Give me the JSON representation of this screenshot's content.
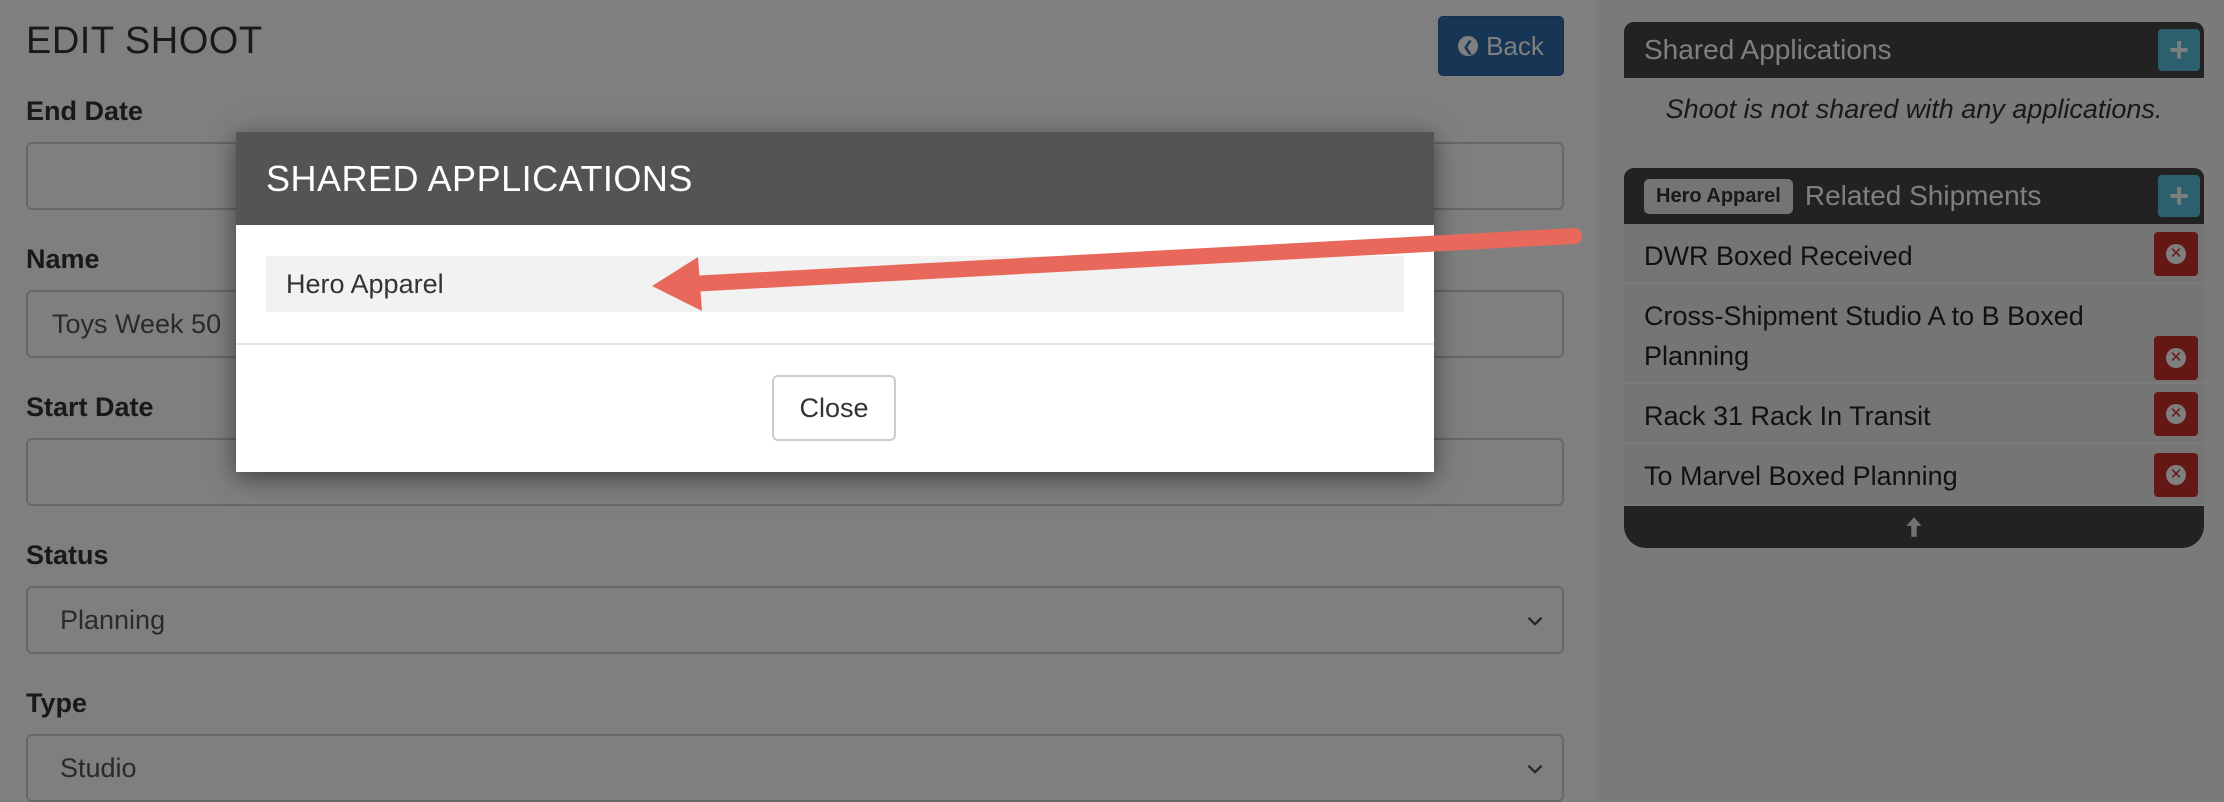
{
  "page": {
    "title": "EDIT SHOOT",
    "back_label": "Back"
  },
  "form": {
    "end_date": {
      "label": "End Date",
      "value": ""
    },
    "name": {
      "label": "Name",
      "value": "Toys Week 50"
    },
    "start_date": {
      "label": "Start Date",
      "value": ""
    },
    "status": {
      "label": "Status",
      "value": "Planning"
    },
    "type": {
      "label": "Type",
      "value": "Studio"
    }
  },
  "sidebar": {
    "shared_apps": {
      "title": "Shared Applications",
      "empty_text": "Shoot is not shared with any applications."
    },
    "related": {
      "tag": "Hero Apparel",
      "title": "Related Shipments",
      "items": [
        "DWR Boxed Received",
        "Cross-Shipment Studio A to B Boxed Planning",
        "Rack 31 Rack In Transit",
        "To Marvel Boxed Planning"
      ]
    }
  },
  "modal": {
    "title": "SHARED APPLICATIONS",
    "items": [
      "Hero Apparel"
    ],
    "close_label": "Close"
  },
  "colors": {
    "primary": "#2f6aa8",
    "info": "#5bc0de",
    "danger": "#c9302c",
    "panel_header": "#454545",
    "annotation_arrow": "#e8695b"
  }
}
